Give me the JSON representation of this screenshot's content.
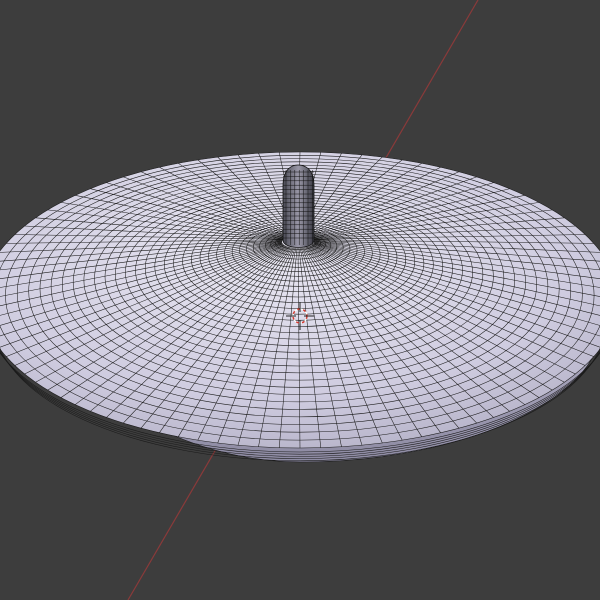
{
  "viewport": {
    "background_color": "#3d3d3d",
    "axis_line_color": "#8a3a3a",
    "mesh_fill_color": "#cfccde",
    "mesh_wire_color": "#1a1a1a",
    "cursor_color_a": "#d43b2f",
    "cursor_color_b": "#ffffff",
    "icons": [
      "3d-cursor-icon"
    ]
  }
}
